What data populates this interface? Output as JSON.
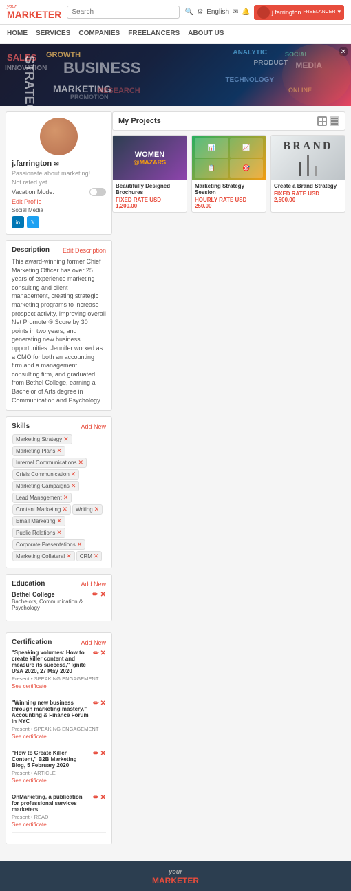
{
  "header": {
    "logo_top": "your",
    "logo_main": "MARKETER",
    "search_placeholder": "Search",
    "lang": "English",
    "user_name": "j.farrington",
    "user_label": "FREELANCER"
  },
  "nav": {
    "items": [
      "HOME",
      "SERVICES",
      "COMPANIES",
      "FREELANCERS",
      "ABOUT US"
    ]
  },
  "hero": {
    "words": [
      "SALES",
      "INNOVATION",
      "STRATEGY",
      "GROWTH",
      "BUSINESS",
      "MARKETING",
      "ANALYTIC",
      "PRODUCT",
      "SOCIAL",
      "MEDIA",
      "TECHNOLOGY",
      "ONLINE",
      "PROMOTION",
      "RESEARCH"
    ]
  },
  "profile": {
    "name": "j.farrington",
    "tagline": "Passionate about marketing!",
    "rating": "Not rated yet",
    "vacation_label": "Vacation Mode:",
    "edit_profile": "Edit Profile",
    "social_media_label": "Social Media",
    "social_icons": [
      "in",
      "🐦"
    ]
  },
  "description": {
    "title": "Description",
    "edit_label": "Edit Description",
    "text": "This award-winning former Chief Marketing Officer has over 25 years of experience marketing consulting and client management, creating strategic marketing programs to increase prospect activity, improving overall Net Promoter® Score by 30 points in two years, and generating new business opportunities. Jennifer worked as a CMO for both an accounting firm and a management consulting firm, and graduated from Bethel College, earning a Bachelor of Arts degree in Communication and Psychology."
  },
  "skills": {
    "title": "Skills",
    "add_label": "Add New",
    "items": [
      "Marketing Strategy",
      "Marketing Plans",
      "Internal Communications",
      "Crisis Communication",
      "Marketing Campaigns",
      "Lead Management",
      "Content Marketing",
      "Writing",
      "Email Marketing",
      "Public Relations",
      "Corporate Presentations",
      "Marketing Collateral",
      "CRM"
    ]
  },
  "education": {
    "title": "Education",
    "add_label": "Add New",
    "items": [
      {
        "school": "Bethel College",
        "degree": "Bachelors, Communication & Psychology"
      }
    ]
  },
  "certification": {
    "title": "Certification",
    "add_label": "Add New",
    "items": [
      {
        "title": "\"Speaking volumes: How to create killer content and measure its success,\" Ignite USA 2020, 27 May 2020",
        "meta": "Present  •  SPEAKING ENGAGEMENT",
        "link": "See certificate"
      },
      {
        "title": "\"Winning new business through marketing mastery,\" Accounting & Finance Forum in NYC",
        "meta": "Present  •  SPEAKING ENGAGEMENT",
        "link": "See certificate"
      },
      {
        "title": "\"How to Create Killer Content,\" B2B Marketing Blog, 5 February 2020",
        "meta": "Present  •  ARTICLE",
        "link": "See certificate"
      },
      {
        "title": "OnMarketing, a publication for professional services marketers",
        "meta": "Present  •  READ",
        "link": "See certificate"
      }
    ]
  },
  "projects": {
    "title": "My Projects",
    "items": [
      {
        "name": "Beautifully Designed Brochures",
        "price_type": "FIXED RATE USD 1,200.00",
        "img_type": "women"
      },
      {
        "name": "Marketing Strategy Session",
        "price_type": "HOURLY RATE USD 250.00",
        "img_type": "strategy"
      },
      {
        "name": "Create a Brand Strategy",
        "price_type": "FIXED RATE USD 2,500.00",
        "img_type": "brand"
      }
    ]
  },
  "footer": {
    "logo": "MARKETER"
  }
}
